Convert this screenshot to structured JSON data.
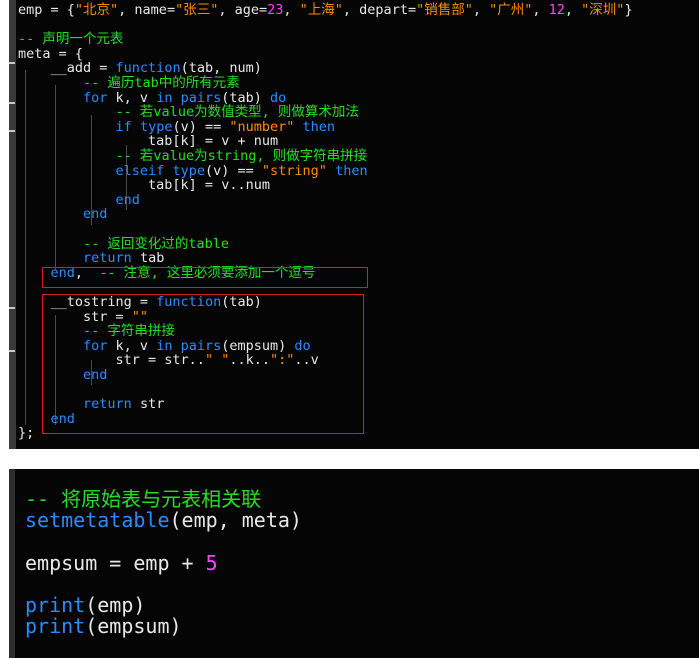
{
  "editor_top": {
    "lines": [
      [
        [
          "emp = {",
          "def"
        ],
        [
          "\"北京\"",
          "str"
        ],
        [
          ", name=",
          "def"
        ],
        [
          "\"张三\"",
          "str"
        ],
        [
          ", age=",
          "def"
        ],
        [
          "23",
          "num"
        ],
        [
          ", ",
          "def"
        ],
        [
          "\"上海\"",
          "str"
        ],
        [
          ", depart=",
          "def"
        ],
        [
          "\"销售部\"",
          "str"
        ],
        [
          ", ",
          "def"
        ],
        [
          "\"广州\"",
          "str"
        ],
        [
          ", ",
          "def"
        ],
        [
          "12",
          "num"
        ],
        [
          ", ",
          "def"
        ],
        [
          "\"深圳\"",
          "str"
        ],
        [
          "}",
          "def"
        ]
      ],
      [],
      [
        [
          "-- 声明一个元表",
          "com"
        ]
      ],
      [
        [
          "meta = {",
          "def"
        ]
      ],
      [
        [
          "    __add = ",
          "def"
        ],
        [
          "function",
          "kw"
        ],
        [
          "(tab, num)",
          "def"
        ]
      ],
      [
        [
          "        ",
          "def"
        ],
        [
          "-- 遍历tab中的所有元素",
          "com"
        ]
      ],
      [
        [
          "        ",
          "def"
        ],
        [
          "for",
          "kw"
        ],
        [
          " k, v ",
          "def"
        ],
        [
          "in",
          "kw"
        ],
        [
          " ",
          "def"
        ],
        [
          "pairs",
          "kw"
        ],
        [
          "(tab) ",
          "def"
        ],
        [
          "do",
          "kw"
        ]
      ],
      [
        [
          "            ",
          "def"
        ],
        [
          "-- 若value为数值类型, 则做算术加法",
          "com"
        ]
      ],
      [
        [
          "            ",
          "def"
        ],
        [
          "if",
          "kw"
        ],
        [
          " ",
          "def"
        ],
        [
          "type",
          "kw"
        ],
        [
          "(v) == ",
          "def"
        ],
        [
          "\"number\"",
          "str"
        ],
        [
          " ",
          "def"
        ],
        [
          "then",
          "kw"
        ]
      ],
      [
        [
          "                tab[k] = v + num",
          "def"
        ]
      ],
      [
        [
          "            ",
          "def"
        ],
        [
          "-- 若value为string, 则做字符串拼接",
          "com"
        ]
      ],
      [
        [
          "            ",
          "def"
        ],
        [
          "elseif",
          "kw"
        ],
        [
          " ",
          "def"
        ],
        [
          "type",
          "kw"
        ],
        [
          "(v) == ",
          "def"
        ],
        [
          "\"string\"",
          "str"
        ],
        [
          " ",
          "def"
        ],
        [
          "then",
          "kw"
        ]
      ],
      [
        [
          "                tab[k] = v..num",
          "def"
        ]
      ],
      [
        [
          "            ",
          "def"
        ],
        [
          "end",
          "kw"
        ]
      ],
      [
        [
          "        ",
          "def"
        ],
        [
          "end",
          "kw"
        ]
      ],
      [],
      [
        [
          "        ",
          "def"
        ],
        [
          "-- 返回变化过的table",
          "com"
        ]
      ],
      [
        [
          "        ",
          "def"
        ],
        [
          "return",
          "kw"
        ],
        [
          " tab",
          "def"
        ]
      ],
      [
        [
          "    ",
          "def"
        ],
        [
          "end",
          "kw"
        ],
        [
          ",  ",
          "def"
        ],
        [
          "-- 注意, 这里必须要添加一个逗号",
          "com"
        ]
      ],
      [],
      [
        [
          "    __tostring = ",
          "def"
        ],
        [
          "function",
          "kw"
        ],
        [
          "(tab)",
          "def"
        ]
      ],
      [
        [
          "        str = ",
          "def"
        ],
        [
          "\"\"",
          "str"
        ]
      ],
      [
        [
          "        ",
          "def"
        ],
        [
          "-- 字符串拼接",
          "com"
        ]
      ],
      [
        [
          "        ",
          "def"
        ],
        [
          "for",
          "kw"
        ],
        [
          " k, v ",
          "def"
        ],
        [
          "in",
          "kw"
        ],
        [
          " ",
          "def"
        ],
        [
          "pairs",
          "kw"
        ],
        [
          "(empsum) ",
          "def"
        ],
        [
          "do",
          "kw"
        ]
      ],
      [
        [
          "            str = str..",
          "def"
        ],
        [
          "\" \"",
          "str"
        ],
        [
          "..k..",
          "def"
        ],
        [
          "\":\"",
          "str"
        ],
        [
          "..v",
          "def"
        ]
      ],
      [
        [
          "        ",
          "def"
        ],
        [
          "end",
          "kw"
        ]
      ],
      [],
      [
        [
          "        ",
          "def"
        ],
        [
          "return",
          "kw"
        ],
        [
          " str",
          "def"
        ]
      ],
      [
        [
          "    ",
          "def"
        ],
        [
          "end",
          "kw"
        ]
      ],
      [
        [
          "};",
          "def"
        ]
      ]
    ]
  },
  "editor_bottom": {
    "lines": [
      [
        [
          "-- 将原始表与元表相关联",
          "com"
        ]
      ],
      [
        [
          "setmetatable",
          "kw"
        ],
        [
          "(emp, meta)",
          "def"
        ]
      ],
      [],
      [
        [
          "empsum = emp + ",
          "def"
        ],
        [
          "5",
          "num"
        ]
      ],
      [],
      [
        [
          "print",
          "kw"
        ],
        [
          "(emp)",
          "def"
        ]
      ],
      [
        [
          "print",
          "kw"
        ],
        [
          "(empsum)",
          "def"
        ]
      ]
    ]
  },
  "colors": {
    "background": "#050505",
    "default": "#e8e8e8",
    "string": "#ff8c00",
    "number": "#ff44ff",
    "comment": "#23e023",
    "keyword": "#2a8cff",
    "highlight_box": "#d32020"
  }
}
